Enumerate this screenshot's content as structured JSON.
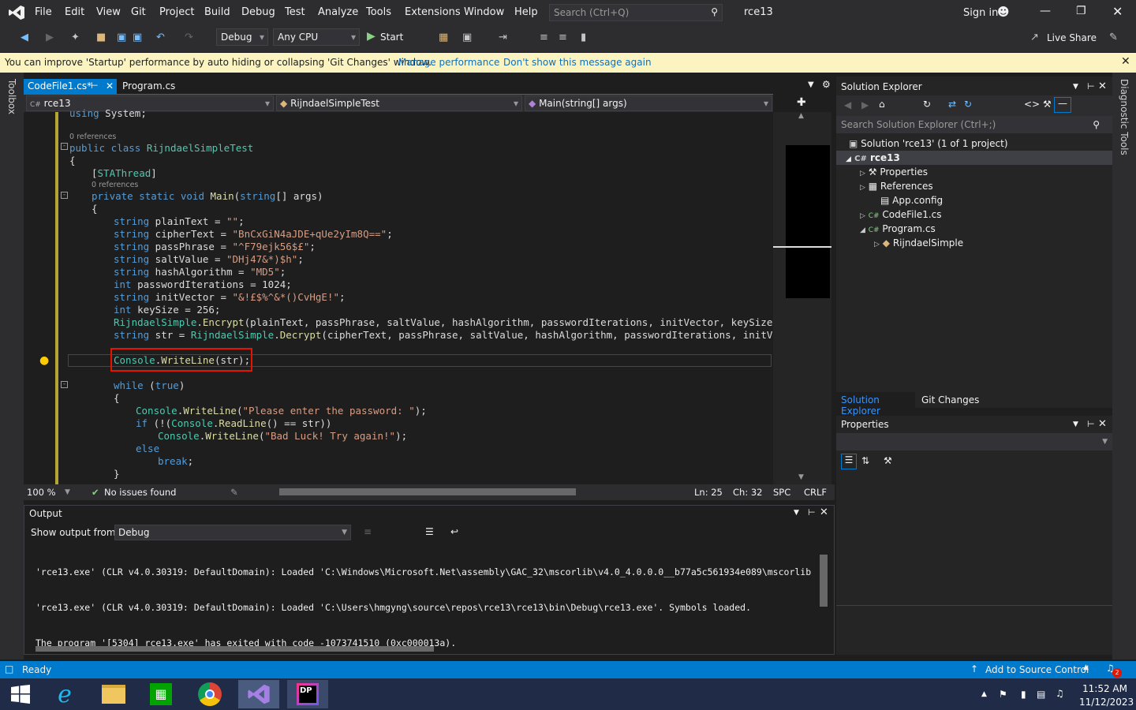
{
  "menu": [
    "File",
    "Edit",
    "View",
    "Git",
    "Project",
    "Build",
    "Debug",
    "Test",
    "Analyze",
    "Tools",
    "Extensions",
    "Window",
    "Help"
  ],
  "search": {
    "placeholder": "Search (Ctrl+Q)"
  },
  "solution_name": "rce13",
  "sign_in": "Sign in",
  "toolbar": {
    "config": "Debug",
    "platform": "Any CPU",
    "start": "Start",
    "live_share": "Live Share"
  },
  "infobar": {
    "message": "You can improve 'Startup' performance by auto hiding or collapsing 'Git Changes' window.",
    "manage": "Manage performance",
    "dont_show": "Don't show this message again"
  },
  "side_tabs": {
    "toolbox": "Toolbox",
    "diagnostic": "Diagnostic Tools"
  },
  "editor": {
    "tabs": [
      {
        "label": "CodeFile1.cs*"
      },
      {
        "label": "Program.cs"
      }
    ],
    "nav": {
      "project": "rce13",
      "class": "RijndaelSimpleTest",
      "member": "Main(string[] args)"
    },
    "refs": "0 references",
    "zoom": "100 %",
    "issues": "No issues found",
    "ln": "Ln: 25",
    "ch": "Ch: 32",
    "spc": "SPC",
    "crlf": "CRLF"
  },
  "code_lines": [
    "using System;",
    "public class RijndaelSimpleTest",
    "{",
    "[STAThread]",
    "private static void Main(string[] args)",
    "{",
    "string plainText = \"\";",
    "string cipherText = \"BnCxGiN4aJDE+qUe2yIm8Q==\";",
    "string passPhrase = \"^F79ejk56$£\";",
    "string saltValue = \"DHj47&*)$h\";",
    "string hashAlgorithm = \"MD5\";",
    "int passwordIterations = 1024;",
    "string initVector = \"&!£$%^&*()CvHgE!\";",
    "int keySize = 256;",
    "RijndaelSimple.Encrypt(plainText, passPhrase, saltValue, hashAlgorithm, passwordIterations, initVector, keySize);",
    "string str = RijndaelSimple.Decrypt(cipherText, passPhrase, saltValue, hashAlgorithm, passwordIterations, initVector, ke",
    "Console.WriteLine(str);",
    "while (true)",
    "{",
    "Console.WriteLine(\"Please enter the password: \");",
    "if (!(Console.ReadLine() == str))",
    "Console.WriteLine(\"Bad Luck! Try again!\");",
    "else",
    "break;",
    "}"
  ],
  "output": {
    "title": "Output",
    "show_from_label": "Show output from:",
    "source": "Debug",
    "lines": [
      "'rce13.exe' (CLR v4.0.30319: DefaultDomain): Loaded 'C:\\Windows\\Microsoft.Net\\assembly\\GAC_32\\mscorlib\\v4.0_4.0.0.0__b77a5c561934e089\\mscorlib",
      "'rce13.exe' (CLR v4.0.30319: DefaultDomain): Loaded 'C:\\Users\\hmgyng\\source\\repos\\rce13\\rce13\\bin\\Debug\\rce13.exe'. Symbols loaded.",
      "The program '[5304] rce13.exe' has exited with code -1073741510 (0xc000013a)."
    ]
  },
  "solution_explorer": {
    "title": "Solution Explorer",
    "search_placeholder": "Search Solution Explorer (Ctrl+;)",
    "items": [
      {
        "label": "Solution 'rce13' (1 of 1 project)",
        "icon": "solution-icon"
      },
      {
        "label": "rce13",
        "icon": "csproj-icon"
      },
      {
        "label": "Properties",
        "icon": "wrench-icon"
      },
      {
        "label": "References",
        "icon": "references-icon"
      },
      {
        "label": "App.config",
        "icon": "config-icon"
      },
      {
        "label": "CodeFile1.cs",
        "icon": "cs-icon"
      },
      {
        "label": "Program.cs",
        "icon": "cs-icon"
      },
      {
        "label": "RijndaelSimple",
        "icon": "class-icon"
      }
    ],
    "tabs": [
      "Solution Explorer",
      "Git Changes"
    ]
  },
  "properties": {
    "title": "Properties"
  },
  "status": {
    "ready": "Ready",
    "source_control": "Add to Source Control",
    "notifications": "2"
  },
  "taskbar": {
    "time": "11:52 AM",
    "date": "11/12/2023"
  },
  "colors": {
    "accent": "#007acc",
    "highlight_box": "#e51400",
    "infobar": "#fcf4c0"
  }
}
